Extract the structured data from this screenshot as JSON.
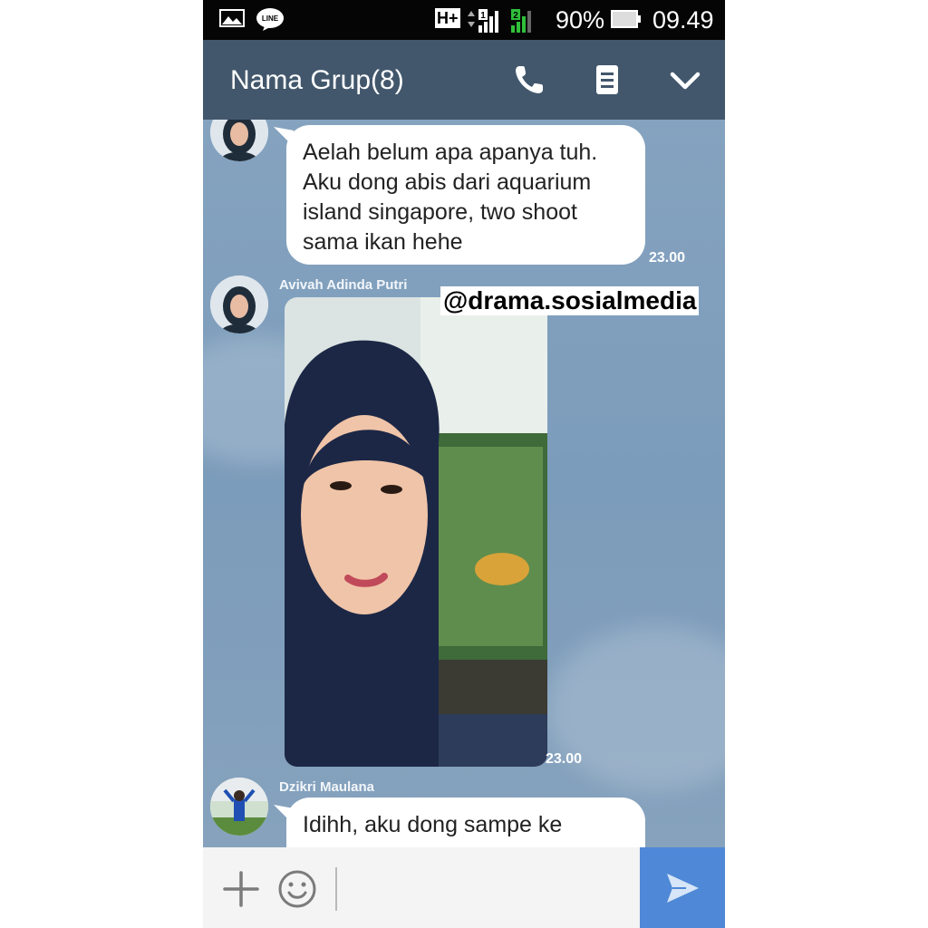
{
  "status_bar": {
    "network_type": "H+",
    "battery_percent": "90%",
    "time": "09.49",
    "icons": [
      "image-notification-icon",
      "line-app-icon",
      "signal-sim1-icon",
      "signal-sim2-icon",
      "battery-icon"
    ],
    "line_logo_text": "LINE"
  },
  "header": {
    "title": "Nama Grup(8)",
    "icons": [
      "phone-icon",
      "notes-icon",
      "chevron-down-icon"
    ],
    "color": "#42576c"
  },
  "messages": [
    {
      "sender": "",
      "text_lines": [
        "Aelah belum apa apanya tuh.",
        "Aku dong abis dari aquarium",
        "island singapore, two shoot",
        "sama ikan hehe"
      ],
      "time": "23.00"
    },
    {
      "sender": "Avivah Adinda Putri",
      "type": "photo",
      "time": "23.00"
    },
    {
      "sender": "Dzikri Maulana",
      "text_lines": [
        "Idihh, aku dong sampe ke"
      ]
    }
  ],
  "watermark": "@drama.sosialmedia",
  "input_bar": {
    "placeholder": "",
    "icons": [
      "plus-icon",
      "emoji-icon",
      "send-icon"
    ],
    "send_color": "#4f88d6"
  }
}
